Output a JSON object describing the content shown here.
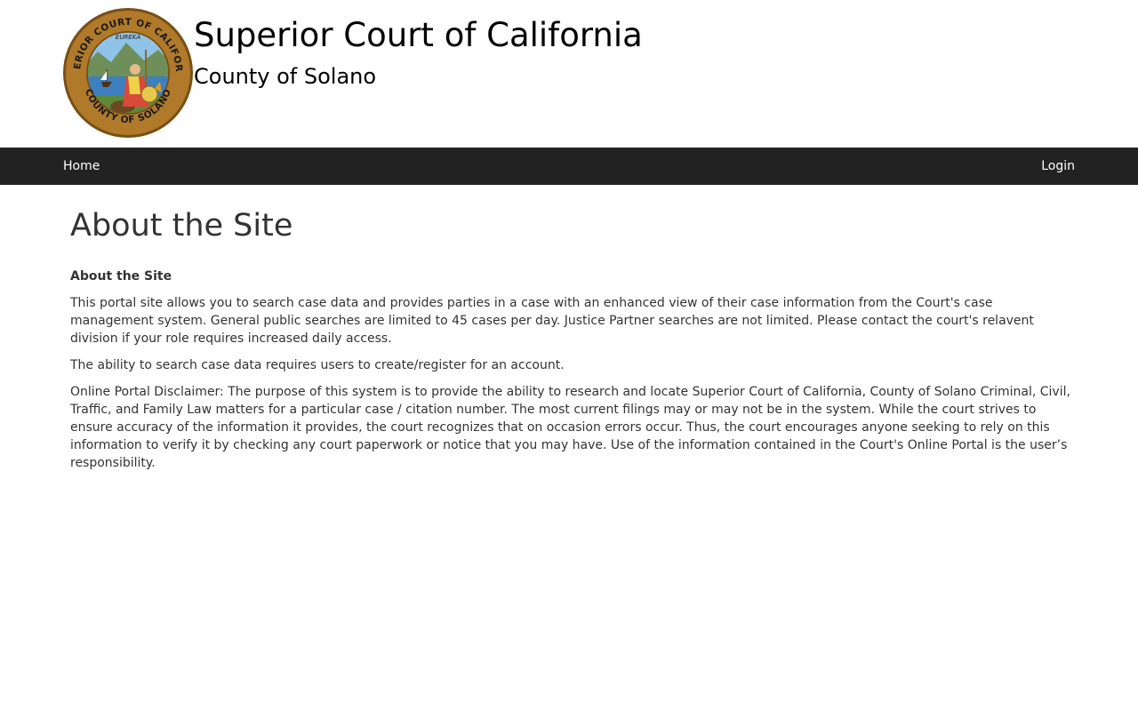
{
  "header": {
    "title": "Superior Court of California",
    "subtitle": "County of Solano",
    "seal_text_top": "SUPERIOR COURT OF CALIFORNIA",
    "seal_text_bottom": "COUNTY OF SOLANO",
    "seal_motto": "EUREKA",
    "seal_colors": {
      "rim": "#b07a2a",
      "rim_dark": "#7a4e14",
      "sky": "#8fc3e8",
      "water": "#3d7fbf",
      "land": "#5c8a3a"
    }
  },
  "nav": {
    "home_label": "Home",
    "login_label": "Login",
    "bg_color": "#222222"
  },
  "main": {
    "page_title": "About the Site",
    "section_heading": "About the Site",
    "paragraphs": [
      "This portal site allows you to search case data and provides parties in a case with an enhanced view of their case information from the Court's case management system. General public searches are limited to 45 cases per day. Justice Partner searches are not limited. Please contact the court's relavent division if your role requires increased daily access.",
      "The ability to search case data requires users to create/register for an account.",
      "Online Portal Disclaimer: The purpose of this system is to provide the ability to research and locate Superior Court of California, County of Solano Criminal, Civil, Traffic, and Family Law matters for a particular case / citation number. The most current filings may or may not be in the system. While the court strives to ensure accuracy of the information it provides, the court recognizes that on occasion errors occur. Thus, the court encourages anyone seeking to rely on this information to verify it by checking any court paperwork or notice that you may have. Use of the information contained in the Court's Online Portal is the user’s responsibility."
    ]
  }
}
